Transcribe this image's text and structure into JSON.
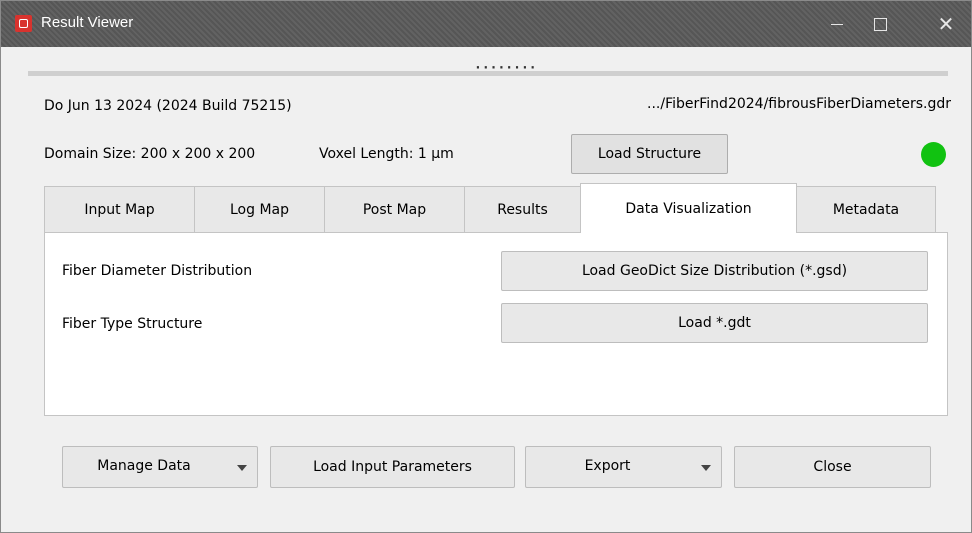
{
  "window": {
    "title": "Result Viewer",
    "controls": {
      "minimize": "—",
      "maximize": "☐",
      "close": "✕"
    }
  },
  "splitter": {
    "handle": "········"
  },
  "header": {
    "date_build": "Do Jun 13 2024 (2024 Build 75215)",
    "file_path": ".../FiberFind2024/fibrousFiberDiameters.gdr",
    "domain_size": "Domain Size: 200 x 200 x 200",
    "voxel_length": "Voxel Length: 1 µm",
    "load_structure_label": "Load Structure",
    "status_color": "#11c211"
  },
  "tabs": [
    {
      "label": "Input Map",
      "active": false
    },
    {
      "label": "Log Map",
      "active": false
    },
    {
      "label": "Post Map",
      "active": false
    },
    {
      "label": "Results",
      "active": false
    },
    {
      "label": "Data Visualization",
      "active": true
    },
    {
      "label": "Metadata",
      "active": false
    }
  ],
  "panel": {
    "rows": [
      {
        "label": "Fiber Diameter Distribution",
        "button": "Load GeoDict Size Distribution (*.gsd)"
      },
      {
        "label": "Fiber Type Structure",
        "button": "Load *.gdt"
      }
    ]
  },
  "footer": {
    "manage_data": "Manage Data",
    "load_input_parameters": "Load Input Parameters",
    "export": "Export",
    "close": "Close"
  }
}
